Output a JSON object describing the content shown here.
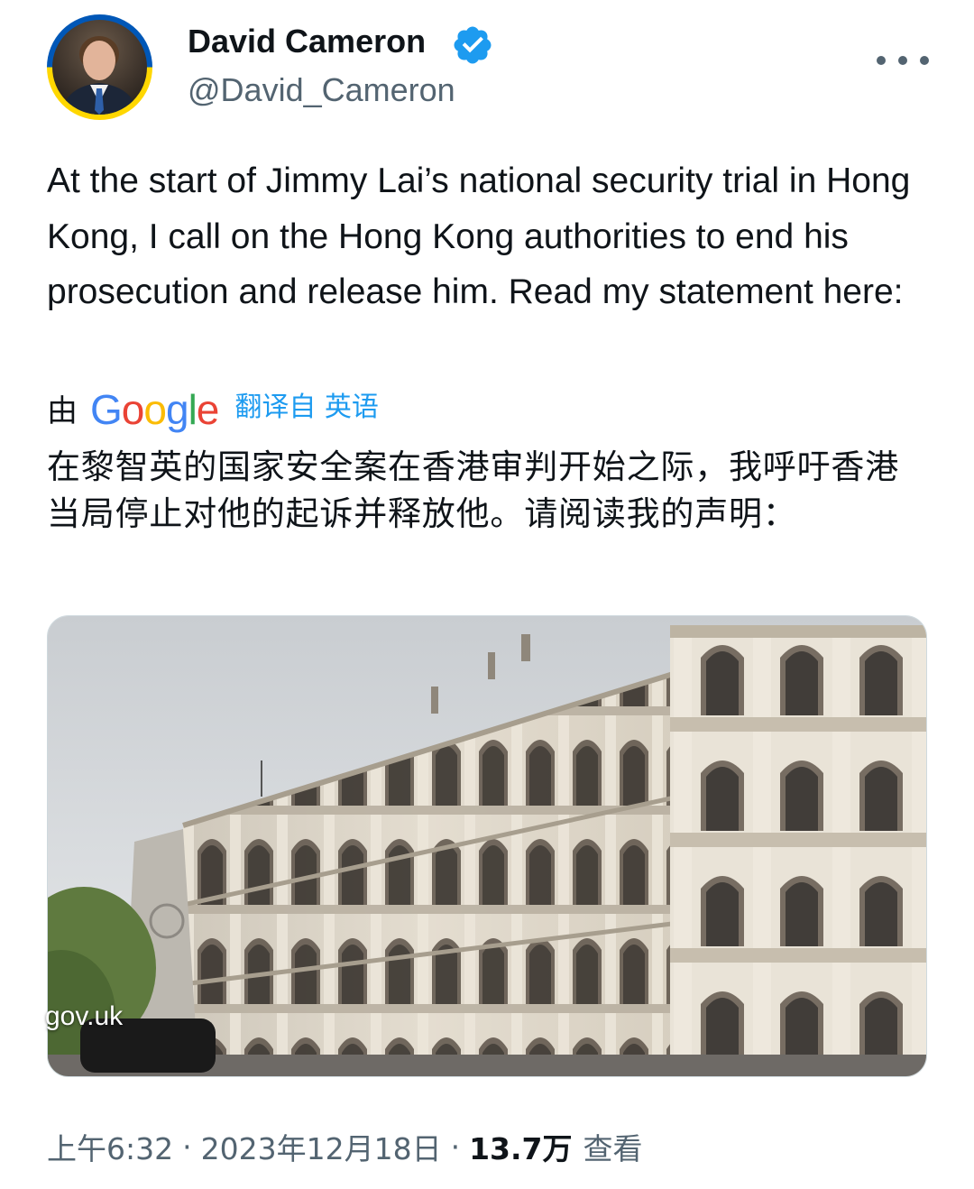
{
  "author": {
    "display_name": "David Cameron",
    "handle": "@David_Cameron",
    "verified_icon": "verified-badge-icon",
    "avatar_ring_colors": [
      "#0057b7",
      "#ffd700"
    ],
    "more_icon": "more-horizontal-icon"
  },
  "tweet": {
    "text": "At the start of Jimmy Lai’s national security trial in Hong Kong, I call on the Hong Kong authorities to end his prosecution and release him. Read my statement here:"
  },
  "translation": {
    "by_label": "由",
    "provider": "Google",
    "provider_colors": [
      "#4285f4",
      "#ea4335",
      "#fbbc05",
      "#4285f4",
      "#34a853",
      "#ea4335"
    ],
    "link_label": "翻译自 英语",
    "text": "在黎智英的国家安全案在香港审判开始之际，我呼吁香港当局停止对他的起诉并释放他。请阅读我的声明："
  },
  "card": {
    "domain": "gov.uk"
  },
  "meta": {
    "time": "上午6:32",
    "separator": "·",
    "date": "2023年12月18日",
    "views_count": "13.7万",
    "views_label": "查看"
  },
  "colors": {
    "text_primary": "#0f1419",
    "text_secondary": "#536471",
    "link": "#1d9bf0"
  }
}
